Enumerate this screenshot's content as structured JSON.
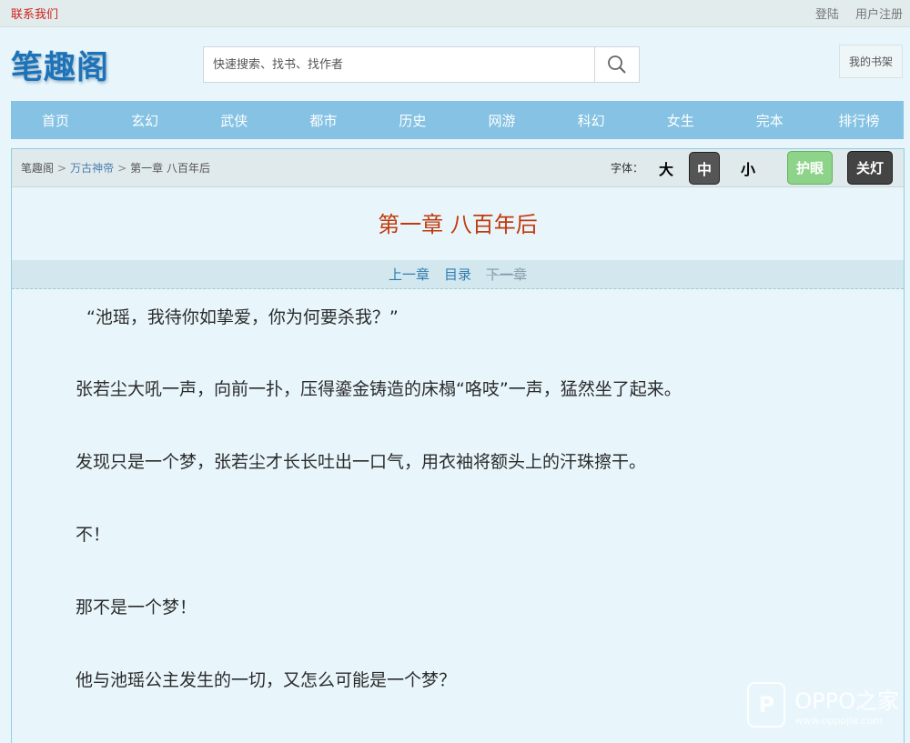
{
  "topbar": {
    "contact": "联系我们",
    "login": "登陆",
    "register": "用户注册"
  },
  "header": {
    "logo": "笔趣阁",
    "search_placeholder": "快速搜索、找书、找作者",
    "bookshelf": "我的书架"
  },
  "nav": [
    "首页",
    "玄幻",
    "武侠",
    "都市",
    "历史",
    "网游",
    "科幻",
    "女生",
    "完本",
    "排行榜"
  ],
  "breadcrumb": {
    "site": "笔趣阁",
    "book": "万古神帝",
    "chapter": "第一章 八百年后"
  },
  "font_control": {
    "label": "字体：",
    "large": "大",
    "medium": "中",
    "small": "小",
    "eye_care": "护眼",
    "lights_off": "关灯"
  },
  "chapter": {
    "title": "第一章 八百年后",
    "prev": "上一章",
    "toc": "目录",
    "next": "下一章",
    "paragraphs": [
      "“池瑶，我待你如挚爱，你为何要杀我？”",
      "张若尘大吼一声，向前一扑，压得鎏金铸造的床榻“咯吱”一声，猛然坐了起来。",
      "发现只是一个梦，张若尘才长长吐出一口气，用衣袖将额头上的汗珠擦干。",
      "不！",
      "那不是一个梦！",
      "他与池瑶公主发生的一切，又怎么可能是一个梦？"
    ]
  },
  "watermark": {
    "badge": "P",
    "brand": "OPPO之家",
    "url": "www.oppojia.com"
  },
  "colors": {
    "nav_bg": "#85c2e3",
    "title": "#c23a0c",
    "contact": "#d0201a",
    "logo": "#1e73b8"
  }
}
